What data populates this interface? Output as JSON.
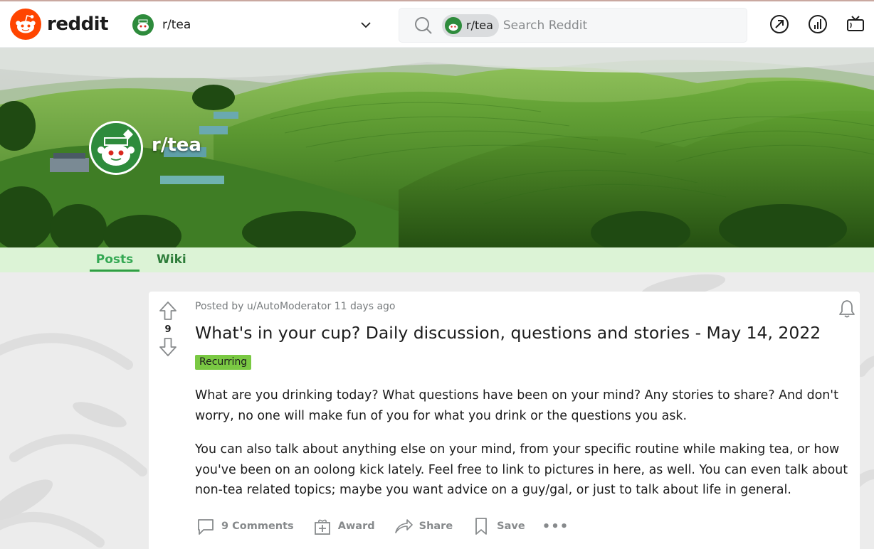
{
  "header": {
    "brand": "reddit",
    "community_selector": "r/tea",
    "search": {
      "chip": "r/tea",
      "placeholder": "Search Reddit"
    }
  },
  "subreddit": {
    "name": "r/tea"
  },
  "tabs": [
    {
      "label": "Posts",
      "active": true
    },
    {
      "label": "Wiki",
      "active": false
    }
  ],
  "post": {
    "meta": "Posted by u/AutoModerator 11 days ago",
    "score": "9",
    "title": "What's in your cup? Daily discussion, questions and stories - May 14, 2022",
    "flair": "Recurring",
    "paragraphs": [
      "What are you drinking today? What questions have been on your mind? Any stories to share? And don't worry, no one will make fun of you for what you drink or the questions you ask.",
      "You can also talk about anything else on your mind, from your specific routine while making tea, or how you've been on an oolong kick lately. Feel free to link to pictures in here, as well. You can even talk about non-tea related topics; maybe you want advice on a guy/gal, or just to talk about life in general."
    ],
    "actions": {
      "comments": "9 Comments",
      "award": "Award",
      "share": "Share",
      "save": "Save",
      "more": "•••"
    }
  },
  "colors": {
    "reddit_orange": "#ff4500",
    "community_green": "#2e8b3c",
    "tab_bar_bg": "#dcf3d6",
    "flair_green": "#7ac943"
  },
  "icons": [
    "reddit-logo-icon",
    "chevron-down-icon",
    "search-icon",
    "popular-icon",
    "stats-icon",
    "tv-icon",
    "bell-icon",
    "upvote-icon",
    "downvote-icon",
    "comment-icon",
    "award-icon",
    "share-icon",
    "save-icon"
  ]
}
